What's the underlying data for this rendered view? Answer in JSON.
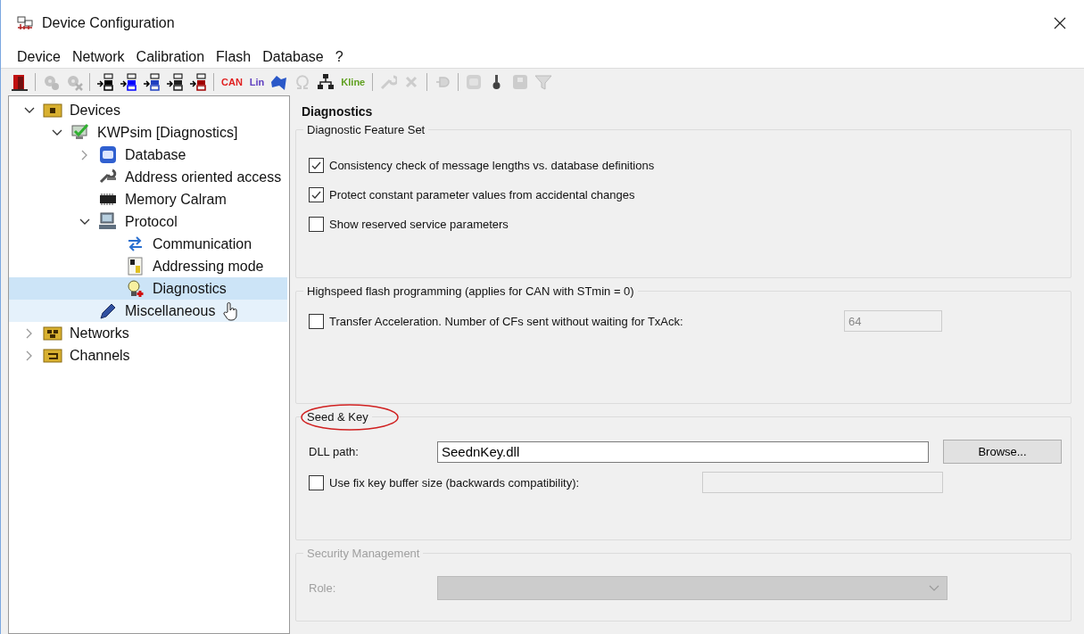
{
  "window": {
    "title": "Device Configuration"
  },
  "menu": [
    "Device",
    "Network",
    "Calibration",
    "Flash",
    "Database",
    "?"
  ],
  "toolbar": [
    {
      "kind": "exit",
      "disabled": false
    },
    {
      "kind": "separator"
    },
    {
      "kind": "gear-check",
      "disabled": true
    },
    {
      "kind": "gear-cross",
      "disabled": true
    },
    {
      "kind": "separator"
    },
    {
      "kind": "network",
      "color": "#000000",
      "disabled": false
    },
    {
      "kind": "network",
      "color": "#0000ff",
      "disabled": false
    },
    {
      "kind": "network",
      "color": "#2040c0",
      "disabled": false
    },
    {
      "kind": "network",
      "color": "#202020",
      "disabled": false
    },
    {
      "kind": "network",
      "color": "#a00000",
      "disabled": false
    },
    {
      "kind": "separator"
    },
    {
      "kind": "text",
      "label": "CAN",
      "color": "#e02020",
      "disabled": false
    },
    {
      "kind": "text",
      "label": "Lin",
      "color": "#6040c0",
      "disabled": false
    },
    {
      "kind": "map",
      "disabled": false
    },
    {
      "kind": "omega",
      "disabled": true
    },
    {
      "kind": "tree",
      "disabled": false
    },
    {
      "kind": "text",
      "label": "Kline",
      "color": "#60a020",
      "disabled": false
    },
    {
      "kind": "separator"
    },
    {
      "kind": "wrench",
      "disabled": true
    },
    {
      "kind": "cross",
      "disabled": true
    },
    {
      "kind": "separator"
    },
    {
      "kind": "plug",
      "disabled": true
    },
    {
      "kind": "separator"
    },
    {
      "kind": "db",
      "disabled": true
    },
    {
      "kind": "pin",
      "disabled": false
    },
    {
      "kind": "p",
      "disabled": true
    },
    {
      "kind": "funnel",
      "disabled": true
    }
  ],
  "tree": [
    {
      "label": "Devices",
      "kind": "folder",
      "expanded": true,
      "selected": false,
      "hovered": false,
      "children": [
        {
          "label": "KWPsim [Diagnostics]",
          "kind": "monitor",
          "expanded": true,
          "selected": false,
          "hovered": false,
          "children": [
            {
              "label": "Database",
              "kind": "db",
              "expanded": false,
              "selected": false,
              "hovered": false
            },
            {
              "label": "Address oriented access",
              "kind": "tools",
              "selected": false,
              "hovered": false
            },
            {
              "label": "Memory Calram",
              "kind": "chip",
              "selected": false,
              "hovered": false
            },
            {
              "label": "Protocol",
              "kind": "computer",
              "expanded": true,
              "selected": false,
              "hovered": false,
              "children": [
                {
                  "label": "Communication",
                  "kind": "arrows",
                  "selected": false,
                  "hovered": false
                },
                {
                  "label": "Addressing mode",
                  "kind": "document",
                  "selected": false,
                  "hovered": false
                },
                {
                  "label": "Diagnostics",
                  "kind": "bulb",
                  "selected": true,
                  "hovered": false
                }
              ]
            },
            {
              "label": "Miscellaneous",
              "kind": "pen",
              "selected": false,
              "hovered": true
            }
          ]
        }
      ]
    },
    {
      "label": "Networks",
      "kind": "folder-net",
      "expanded": false,
      "selected": false,
      "hovered": false
    },
    {
      "label": "Channels",
      "kind": "folder-channel",
      "expanded": false,
      "selected": false,
      "hovered": false
    }
  ],
  "panel": {
    "title": "Diagnostics",
    "sections": [
      {
        "title": "Diagnostic Feature Set",
        "disabled": false,
        "circled": false,
        "rows": [
          {
            "kind": "checkbox",
            "label": "Consistency check of message lengths vs. database definitions",
            "checked": true
          },
          {
            "kind": "checkbox",
            "label": "Protect constant parameter values from accidental changes",
            "checked": true
          },
          {
            "kind": "checkbox",
            "label": "Show reserved service parameters",
            "checked": false
          }
        ]
      },
      {
        "title": "Highspeed flash programming (applies for CAN with STmin = 0)",
        "disabled": false,
        "circled": false,
        "rows": [
          {
            "kind": "checkbox-field",
            "label": "Transfer Acceleration. Number of CFs sent without waiting for TxAck:",
            "checked": false,
            "value": "64",
            "field_disabled": true
          }
        ]
      },
      {
        "title": "Seed & Key",
        "disabled": false,
        "circled": true,
        "rows": [
          {
            "kind": "path",
            "label": "DLL path:",
            "value": "SeednKey.dll",
            "button": "Browse..."
          },
          {
            "kind": "checkbox-field",
            "label": "Use fix key buffer size (backwards compatibility):",
            "checked": false,
            "field_disabled": true
          }
        ]
      },
      {
        "title": "Security Management",
        "disabled": true,
        "circled": false,
        "rows": [
          {
            "kind": "select",
            "label": "Role:"
          }
        ]
      }
    ]
  }
}
